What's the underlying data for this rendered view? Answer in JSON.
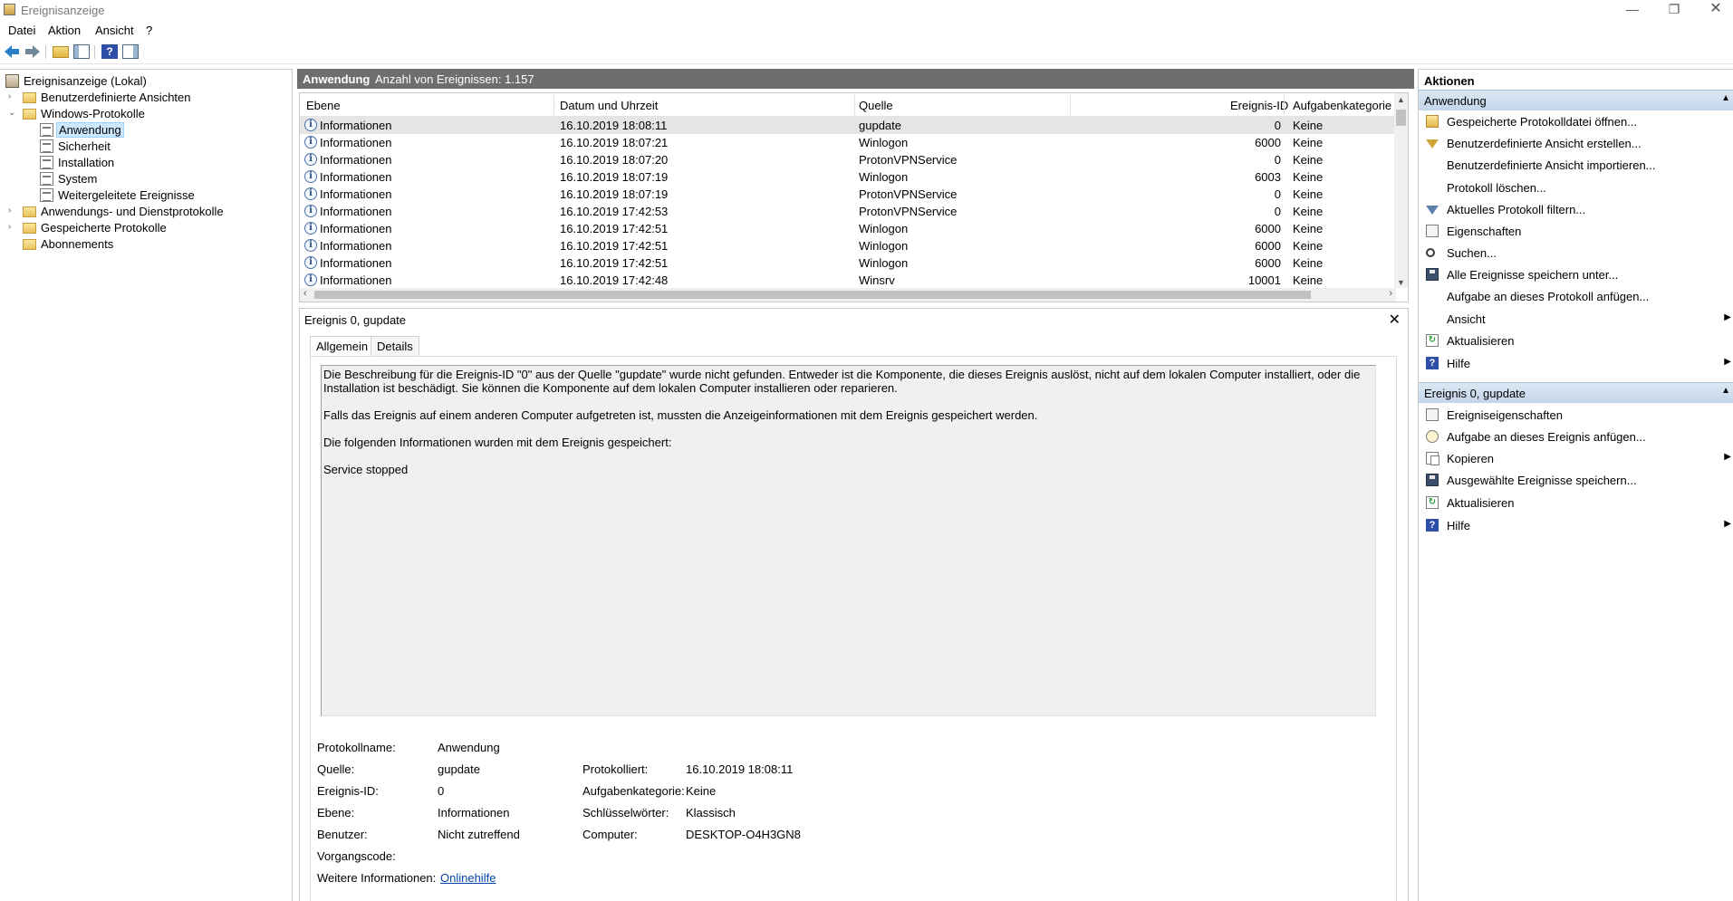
{
  "window": {
    "title": "Ereignisanzeige",
    "controls": [
      "—",
      "❐",
      "✕"
    ]
  },
  "menu": [
    "Datei",
    "Aktion",
    "Ansicht",
    "?"
  ],
  "tree": {
    "root": "Ereignisanzeige (Lokal)",
    "custom_views": "Benutzerdefinierte Ansichten",
    "windows_logs": "Windows-Protokolle",
    "logs": [
      "Anwendung",
      "Sicherheit",
      "Installation",
      "System",
      "Weitergeleitete Ereignisse"
    ],
    "app_service_logs": "Anwendungs- und Dienstprotokolle",
    "saved_logs": "Gespeicherte Protokolle",
    "subscriptions": "Abonnements"
  },
  "center": {
    "log_name": "Anwendung",
    "event_count": "Anzahl von Ereignissen: 1.157"
  },
  "table": {
    "columns": [
      "Ebene",
      "Datum und Uhrzeit",
      "Quelle",
      "Ereignis-ID",
      "Aufgabenkategorie"
    ],
    "rows": [
      {
        "level": "Informationen",
        "datetime": "16.10.2019 18:08:11",
        "source": "gupdate",
        "id": "0",
        "category": "Keine"
      },
      {
        "level": "Informationen",
        "datetime": "16.10.2019 18:07:21",
        "source": "Winlogon",
        "id": "6000",
        "category": "Keine"
      },
      {
        "level": "Informationen",
        "datetime": "16.10.2019 18:07:20",
        "source": "ProtonVPNService",
        "id": "0",
        "category": "Keine"
      },
      {
        "level": "Informationen",
        "datetime": "16.10.2019 18:07:19",
        "source": "Winlogon",
        "id": "6003",
        "category": "Keine"
      },
      {
        "level": "Informationen",
        "datetime": "16.10.2019 18:07:19",
        "source": "ProtonVPNService",
        "id": "0",
        "category": "Keine"
      },
      {
        "level": "Informationen",
        "datetime": "16.10.2019 17:42:53",
        "source": "ProtonVPNService",
        "id": "0",
        "category": "Keine"
      },
      {
        "level": "Informationen",
        "datetime": "16.10.2019 17:42:51",
        "source": "Winlogon",
        "id": "6000",
        "category": "Keine"
      },
      {
        "level": "Informationen",
        "datetime": "16.10.2019 17:42:51",
        "source": "Winlogon",
        "id": "6000",
        "category": "Keine"
      },
      {
        "level": "Informationen",
        "datetime": "16.10.2019 17:42:51",
        "source": "Winlogon",
        "id": "6000",
        "category": "Keine"
      },
      {
        "level": "Informationen",
        "datetime": "16.10.2019 17:42:48",
        "source": "Winsrv",
        "id": "10001",
        "category": "Keine"
      }
    ]
  },
  "detail": {
    "title": "Ereignis 0, gupdate",
    "tabs": [
      "Allgemein",
      "Details"
    ],
    "description": [
      "Die Beschreibung für die Ereignis-ID \"0\" aus der Quelle \"gupdate\" wurde nicht gefunden. Entweder ist die Komponente, die dieses Ereignis auslöst, nicht auf dem lokalen Computer installiert, oder die Installation ist beschädigt. Sie können die Komponente auf dem lokalen Computer installieren oder reparieren.",
      "Falls das Ereignis auf einem anderen Computer aufgetreten ist, mussten die Anzeigeinformationen mit dem Ereignis gespeichert werden.",
      "Die folgenden Informationen wurden mit dem Ereignis gespeichert:",
      "Service stopped"
    ],
    "props": {
      "logname_label": "Protokollname:",
      "logname": "Anwendung",
      "source_label": "Quelle:",
      "source": "gupdate",
      "logged_label": "Protokolliert:",
      "logged": "16.10.2019 18:08:11",
      "id_label": "Ereignis-ID:",
      "id": "0",
      "category_label": "Aufgabenkategorie:",
      "category": "Keine",
      "level_label": "Ebene:",
      "level": "Informationen",
      "keywords_label": "Schlüsselwörter:",
      "keywords": "Klassisch",
      "user_label": "Benutzer:",
      "user": "Nicht zutreffend",
      "computer_label": "Computer:",
      "computer": "DESKTOP-O4H3GN8",
      "opcode_label": "Vorgangscode:",
      "opcode": "",
      "moreinfo_label": "Weitere Informationen:",
      "moreinfo_link": "Onlinehilfe"
    }
  },
  "actions": {
    "title": "Aktionen",
    "section1": "Anwendung",
    "items1": [
      "Gespeicherte Protokolldatei öffnen...",
      "Benutzerdefinierte Ansicht erstellen...",
      "Benutzerdefinierte Ansicht importieren...",
      "Protokoll löschen...",
      "Aktuelles Protokoll filtern...",
      "Eigenschaften",
      "Suchen...",
      "Alle Ereignisse speichern unter...",
      "Aufgabe an dieses Protokoll anfügen...",
      "Ansicht",
      "Aktualisieren",
      "Hilfe"
    ],
    "section2": "Ereignis 0, gupdate",
    "items2": [
      "Ereigniseigenschaften",
      "Aufgabe an dieses Ereignis anfügen...",
      "Kopieren",
      "Ausgewählte Ereignisse speichern...",
      "Aktualisieren",
      "Hilfe"
    ]
  }
}
